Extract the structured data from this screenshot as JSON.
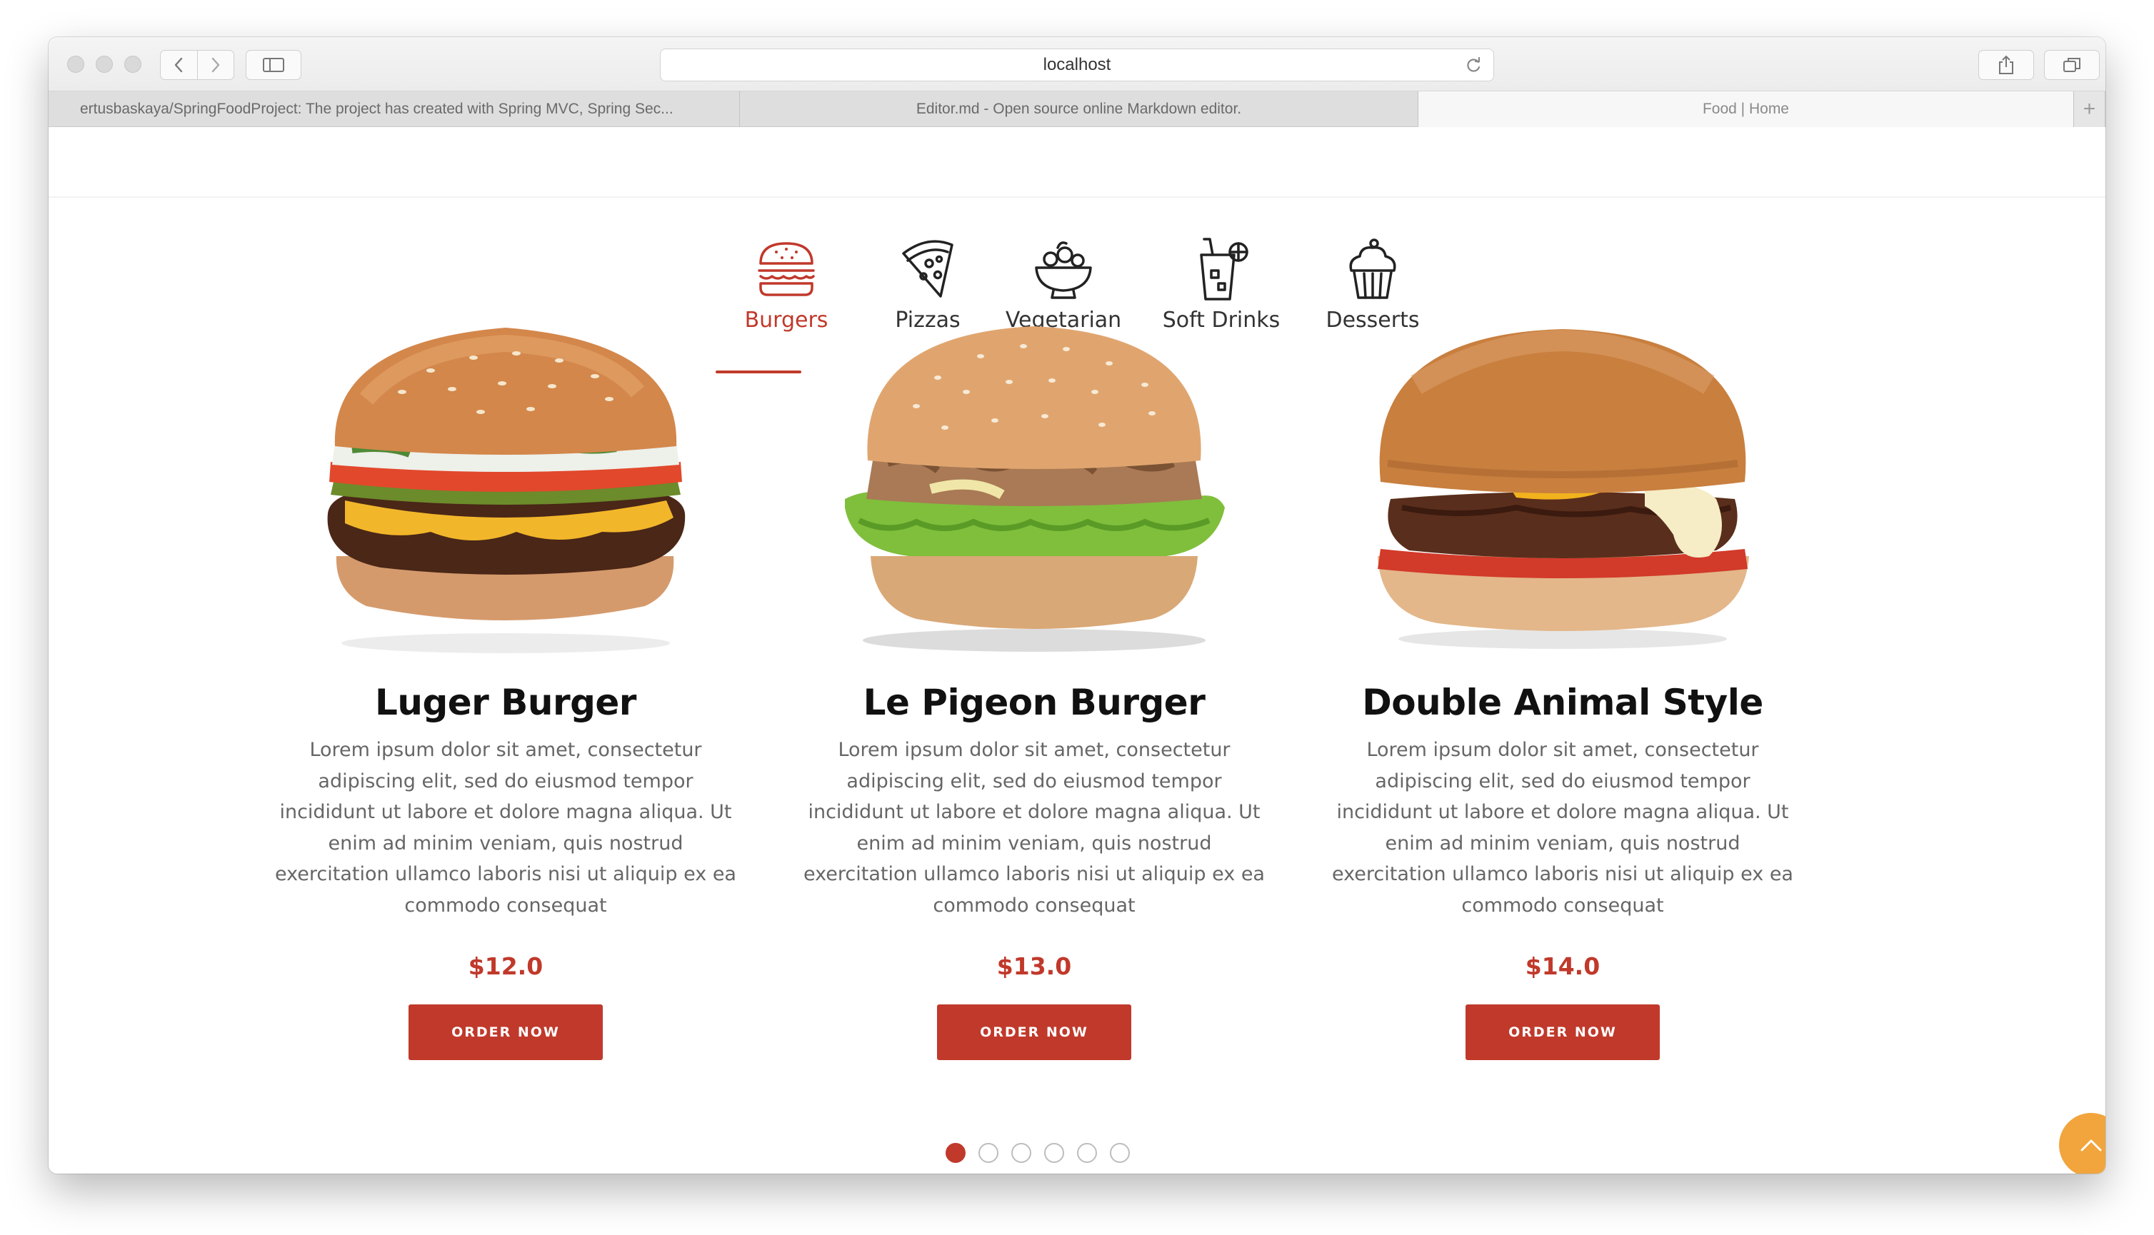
{
  "browser": {
    "url": "localhost",
    "tabs": [
      {
        "label": "ertusbaskaya/SpringFoodProject: The project has created with Spring MVC, Spring Sec..."
      },
      {
        "label": "Editor.md - Open source online Markdown editor."
      },
      {
        "label": "Food | Home"
      }
    ],
    "new_tab": "+"
  },
  "categories": [
    {
      "label": "Burgers",
      "icon": "burger-icon",
      "active": true
    },
    {
      "label": "Pizzas",
      "icon": "pizza-icon"
    },
    {
      "label": "Vegetarian",
      "icon": "salad-bowl-icon"
    },
    {
      "label": "Soft Drinks",
      "icon": "drink-cup-icon"
    },
    {
      "label": "Desserts",
      "icon": "cupcake-icon"
    }
  ],
  "products": [
    {
      "name": "Luger Burger",
      "description": "Lorem ipsum dolor sit amet, consectetur adipiscing elit, sed do eiusmod tempor incididunt ut labore et dolore magna aliqua. Ut enim ad minim veniam, quis nostrud exercitation ullamco laboris nisi ut aliquip ex ea commodo consequat",
      "price": "$12.0",
      "button": "ORDER NOW"
    },
    {
      "name": "Le Pigeon Burger",
      "description": "Lorem ipsum dolor sit amet, consectetur adipiscing elit, sed do eiusmod tempor incididunt ut labore et dolore magna aliqua. Ut enim ad minim veniam, quis nostrud exercitation ullamco laboris nisi ut aliquip ex ea commodo consequat",
      "price": "$13.0",
      "button": "ORDER NOW"
    },
    {
      "name": "Double Animal Style",
      "description": "Lorem ipsum dolor sit amet, consectetur adipiscing elit, sed do eiusmod tempor incididunt ut labore et dolore magna aliqua. Ut enim ad minim veniam, quis nostrud exercitation ullamco laboris nisi ut aliquip ex ea commodo consequat",
      "price": "$14.0",
      "button": "ORDER NOW"
    }
  ],
  "carousel": {
    "pages": 6,
    "active_index": 0
  },
  "colors": {
    "accent": "#c0392b",
    "back_to_top": "#f1a53c"
  }
}
